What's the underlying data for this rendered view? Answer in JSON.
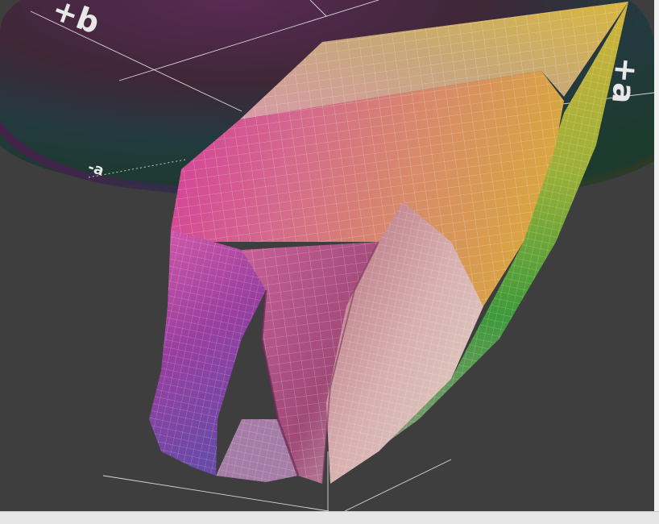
{
  "view": {
    "axis_labels": {
      "plus_b": "+b",
      "plus_a": "+a",
      "minus_a": "-a"
    }
  },
  "colors": {
    "background": "#3e3e3e",
    "grid_line": "#d8d8d8",
    "mesh_line": "#ffffff"
  }
}
